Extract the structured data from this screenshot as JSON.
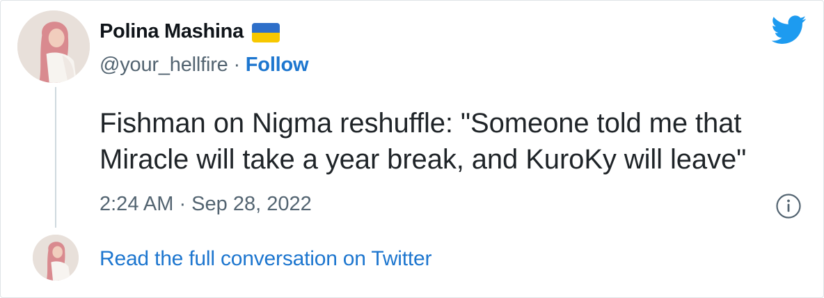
{
  "author": {
    "name": "Polina Mashina",
    "handle": "@your_hellfire",
    "separator": " · ",
    "follow_label": "Follow",
    "flag_icon": "ukraine-flag-icon",
    "avatar_icon": "user-avatar"
  },
  "tweet": {
    "lines": [
      "Fishman on Nigma reshuffle: \"Someone told me that",
      "Miracle will take a year break, and KuroKy will leave\""
    ],
    "timestamp": "2:24 AM · Sep 28, 2022"
  },
  "footer": {
    "read_label": "Read the full conversation on Twitter"
  },
  "colors": {
    "accent": "#1d76cf",
    "twitter_blue": "#1d9bf0",
    "muted": "#536471",
    "flag_blue": "#2e6fc9",
    "flag_yellow": "#f7c800"
  }
}
